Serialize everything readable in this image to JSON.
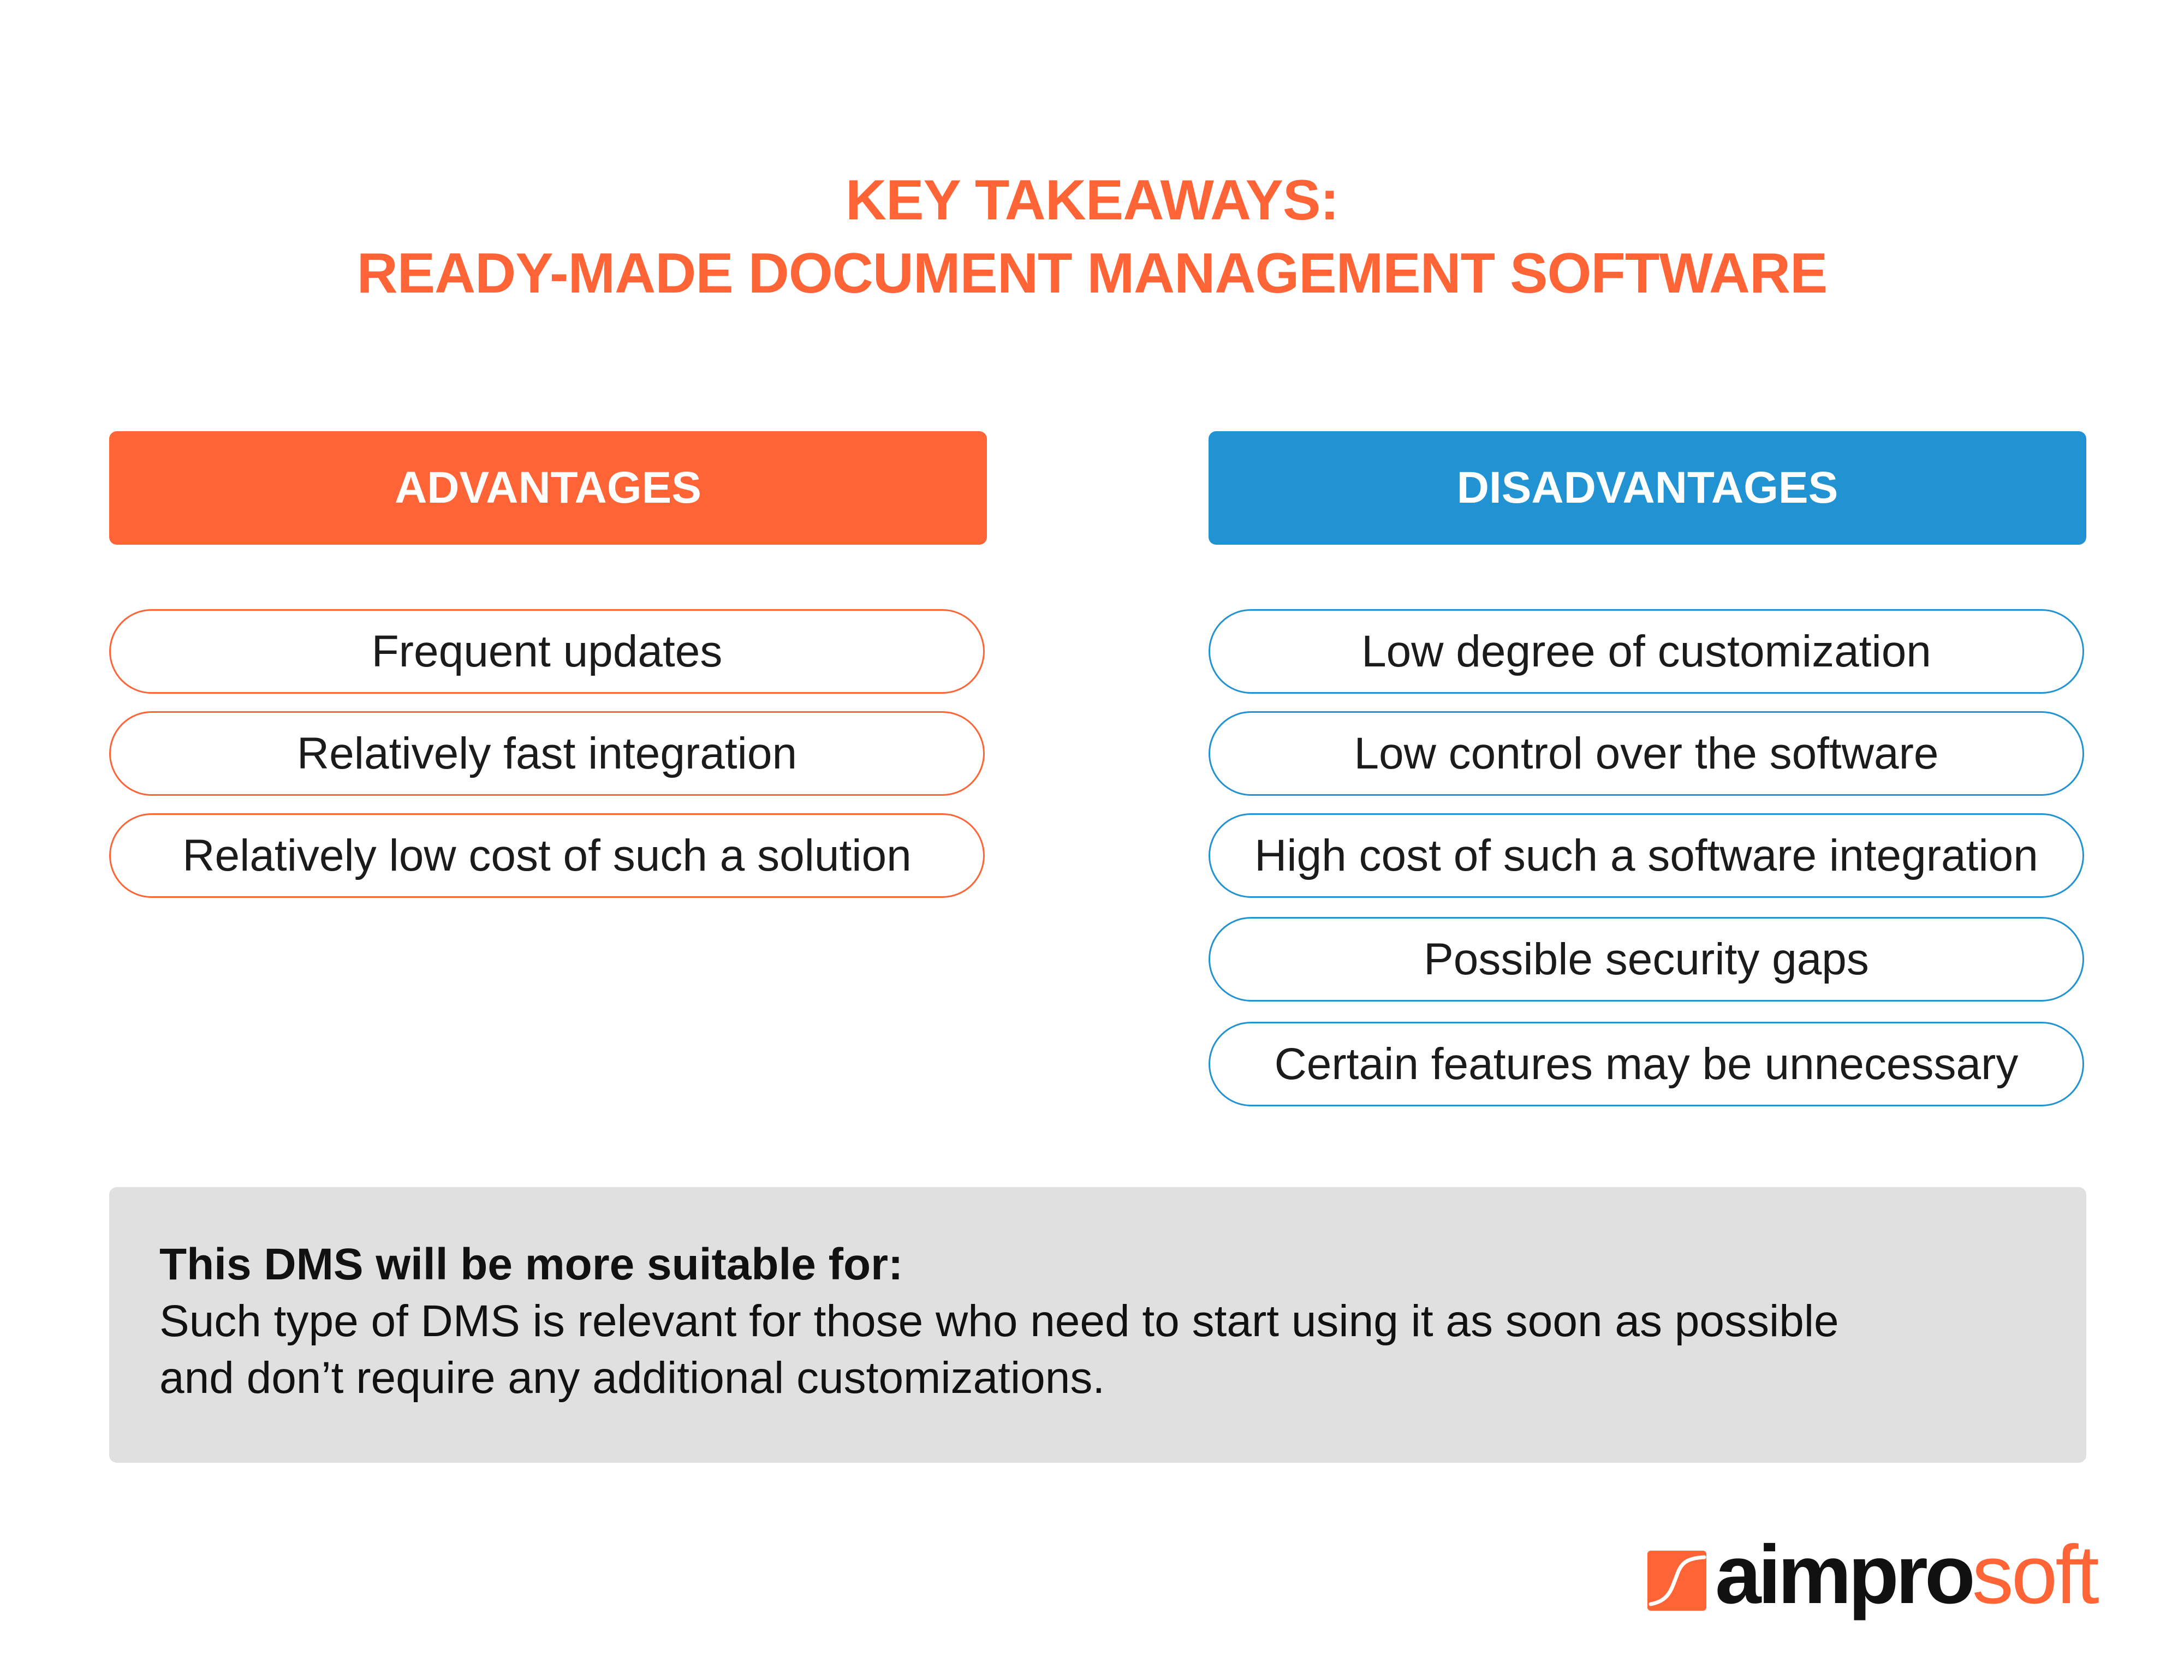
{
  "title": {
    "line1": "KEY TAKEAWAYS:",
    "line2": "READY-MADE DOCUMENT MANAGEMENT SOFTWARE"
  },
  "advantages": {
    "header": "ADVANTAGES",
    "items": [
      "Frequent updates",
      "Relatively fast integration",
      "Relatively low cost of such a solution"
    ]
  },
  "disadvantages": {
    "header": "DISADVANTAGES",
    "items": [
      "Low degree of customization",
      "Low control over the software",
      "High cost of such a software integration",
      "Possible security gaps",
      "Certain features may be unnecessary"
    ]
  },
  "summary": {
    "heading": "This DMS will be more suitable for:",
    "line1": "Such type of DMS is relevant for those who need to start using it as soon as possible",
    "line2": "and don’t require any additional customizations."
  },
  "logo": {
    "part1": "aimpro",
    "part2": "soft",
    "icon": "aimprosoft-mark-icon"
  },
  "colors": {
    "accent_orange": "#ff6436",
    "accent_blue": "#2192d2",
    "summary_bg": "#e0e0e0"
  }
}
